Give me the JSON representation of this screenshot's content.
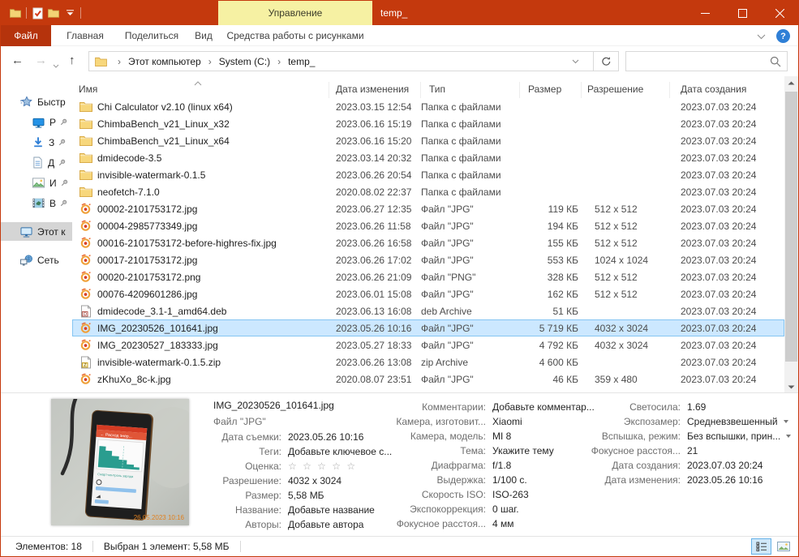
{
  "titlebar": {
    "context_tab": "Управление",
    "title": "temp_"
  },
  "ribbon": {
    "file": "Файл",
    "tabs": [
      "Главная",
      "Поделиться",
      "Вид"
    ],
    "context_tab": "Средства работы с рисунками",
    "help_label": "?"
  },
  "address": {
    "crumbs": [
      "Этот компьютер",
      "System (C:)",
      "temp_"
    ],
    "separator": "›",
    "search_placeholder": ""
  },
  "columns": {
    "name": "Имя",
    "modified": "Дата изменения",
    "type": "Тип",
    "size": "Размер",
    "resolution": "Разрешение",
    "created": "Дата создания"
  },
  "sidebar": {
    "items": [
      {
        "label": "Быстр"
      },
      {
        "label": "Р"
      },
      {
        "label": "З"
      },
      {
        "label": "Д"
      },
      {
        "label": "И"
      },
      {
        "label": "В"
      },
      {
        "label": "Этот к"
      },
      {
        "label": "Сеть"
      }
    ]
  },
  "files": [
    {
      "icon": "folder",
      "name": "Chi Calculator v2.10 (linux x64)",
      "modified": "2023.03.15 12:54",
      "type": "Папка с файлами",
      "size": "",
      "resolution": "",
      "created": "2023.07.03 20:24"
    },
    {
      "icon": "folder",
      "name": "ChimbaBench_v21_Linux_x32",
      "modified": "2023.06.16 15:19",
      "type": "Папка с файлами",
      "size": "",
      "resolution": "",
      "created": "2023.07.03 20:24"
    },
    {
      "icon": "folder",
      "name": "ChimbaBench_v21_Linux_x64",
      "modified": "2023.06.16 15:20",
      "type": "Папка с файлами",
      "size": "",
      "resolution": "",
      "created": "2023.07.03 20:24"
    },
    {
      "icon": "folder",
      "name": "dmidecode-3.5",
      "modified": "2023.03.14 20:32",
      "type": "Папка с файлами",
      "size": "",
      "resolution": "",
      "created": "2023.07.03 20:24"
    },
    {
      "icon": "folder",
      "name": "invisible-watermark-0.1.5",
      "modified": "2023.06.26 20:54",
      "type": "Папка с файлами",
      "size": "",
      "resolution": "",
      "created": "2023.07.03 20:24"
    },
    {
      "icon": "folder",
      "name": "neofetch-7.1.0",
      "modified": "2020.08.02 22:37",
      "type": "Папка с файлами",
      "size": "",
      "resolution": "",
      "created": "2023.07.03 20:24"
    },
    {
      "icon": "image",
      "name": "00002-2101753172.jpg",
      "modified": "2023.06.27 12:35",
      "type": "Файл \"JPG\"",
      "size": "119 КБ",
      "resolution": "512 x 512",
      "created": "2023.07.03 20:24"
    },
    {
      "icon": "image",
      "name": "00004-2985773349.jpg",
      "modified": "2023.06.26 11:58",
      "type": "Файл \"JPG\"",
      "size": "194 КБ",
      "resolution": "512 x 512",
      "created": "2023.07.03 20:24"
    },
    {
      "icon": "image",
      "name": "00016-2101753172-before-highres-fix.jpg",
      "modified": "2023.06.26 16:58",
      "type": "Файл \"JPG\"",
      "size": "155 КБ",
      "resolution": "512 x 512",
      "created": "2023.07.03 20:24"
    },
    {
      "icon": "image",
      "name": "00017-2101753172.jpg",
      "modified": "2023.06.26 17:02",
      "type": "Файл \"JPG\"",
      "size": "553 КБ",
      "resolution": "1024 x 1024",
      "created": "2023.07.03 20:24"
    },
    {
      "icon": "image",
      "name": "00020-2101753172.png",
      "modified": "2023.06.26 21:09",
      "type": "Файл \"PNG\"",
      "size": "328 КБ",
      "resolution": "512 x 512",
      "created": "2023.07.03 20:24"
    },
    {
      "icon": "image",
      "name": "00076-4209601286.jpg",
      "modified": "2023.06.01 15:08",
      "type": "Файл \"JPG\"",
      "size": "162 КБ",
      "resolution": "512 x 512",
      "created": "2023.07.03 20:24"
    },
    {
      "icon": "deb",
      "name": "dmidecode_3.1-1_amd64.deb",
      "modified": "2023.06.13 16:08",
      "type": "deb Archive",
      "size": "51 КБ",
      "resolution": "",
      "created": "2023.07.03 20:24"
    },
    {
      "icon": "image",
      "name": "IMG_20230526_101641.jpg",
      "modified": "2023.05.26 10:16",
      "type": "Файл \"JPG\"",
      "size": "5 719 КБ",
      "resolution": "4032 x 3024",
      "created": "2023.07.03 20:24",
      "selected": true
    },
    {
      "icon": "image",
      "name": "IMG_20230527_183333.jpg",
      "modified": "2023.05.27 18:33",
      "type": "Файл \"JPG\"",
      "size": "4 792 КБ",
      "resolution": "4032 x 3024",
      "created": "2023.07.03 20:24"
    },
    {
      "icon": "zip",
      "name": "invisible-watermark-0.1.5.zip",
      "modified": "2023.06.26 13:08",
      "type": "zip Archive",
      "size": "4 600 КБ",
      "resolution": "",
      "created": "2023.07.03 20:24"
    },
    {
      "icon": "image",
      "name": "zKhuXo_8c-k.jpg",
      "modified": "2020.08.07 23:51",
      "type": "Файл \"JPG\"",
      "size": "46 КБ",
      "resolution": "359 x 480",
      "created": "2023.07.03 20:24"
    }
  ],
  "details": {
    "title": "IMG_20230526_101641.jpg",
    "subtitle": "Файл \"JPG\"",
    "col1": [
      {
        "label": "Дата съемки:",
        "value": "2023.05.26 10:16"
      },
      {
        "label": "Теги:",
        "value": "Добавьте ключевое с..."
      },
      {
        "label": "Оценка:",
        "value": "☆ ☆ ☆ ☆ ☆",
        "stars": true
      },
      {
        "label": "Разрешение:",
        "value": "4032 x 3024"
      },
      {
        "label": "Размер:",
        "value": "5,58 МБ"
      },
      {
        "label": "Название:",
        "value": "Добавьте название"
      },
      {
        "label": "Авторы:",
        "value": "Добавьте автора"
      }
    ],
    "col2": [
      {
        "label": "Комментарии:",
        "value": "Добавьте комментар..."
      },
      {
        "label": "Камера, изготовит...",
        "value": "Xiaomi"
      },
      {
        "label": "Камера, модель:",
        "value": "MI 8"
      },
      {
        "label": "Тема:",
        "value": "Укажите тему"
      },
      {
        "label": "Диафрагма:",
        "value": "f/1.8"
      },
      {
        "label": "Выдержка:",
        "value": "1/100 с."
      },
      {
        "label": "Скорость ISO:",
        "value": "ISO-263"
      },
      {
        "label": "Экспокоррекция:",
        "value": "0 шаг."
      },
      {
        "label": "Фокусное расстоя...",
        "value": "4 мм"
      }
    ],
    "col3": [
      {
        "label": "Светосила:",
        "value": "1.69"
      },
      {
        "label": "Экспозамер:",
        "value": "Средневзвешенный",
        "dropdown": true
      },
      {
        "label": "Вспышка, режим:",
        "value": "Без вспышки, прин...",
        "dropdown": true
      },
      {
        "label": "Фокусное расстоя...",
        "value": "21"
      },
      {
        "label": "Дата создания:",
        "value": "2023.07.03 20:24"
      },
      {
        "label": "Дата изменения:",
        "value": "2023.05.26 10:16"
      }
    ],
    "thumbnail_timestamp": "26.05.2023 10:16"
  },
  "statusbar": {
    "items_count": "Элементов: 18",
    "selection": "Выбран 1 элемент: 5,58 МБ"
  },
  "colors": {
    "accent": "#c4390d",
    "file_tab": "#b5330c",
    "context_tab_bg": "#f6f1a3",
    "selection_bg": "#cce8ff",
    "selection_border": "#84c5f2"
  },
  "icons": [
    "folder-icon",
    "properties-check-icon",
    "qat-dropdown-icon",
    "minimize-icon",
    "maximize-icon",
    "close-icon",
    "help-icon",
    "back-icon",
    "forward-icon",
    "up-icon",
    "refresh-icon",
    "search-icon",
    "quick-access-star-icon",
    "desktop-icon",
    "downloads-icon",
    "documents-icon",
    "pictures-icon",
    "videos-icon",
    "this-pc-icon",
    "network-icon",
    "pin-icon",
    "details-view-icon",
    "thumbnails-view-icon"
  ]
}
